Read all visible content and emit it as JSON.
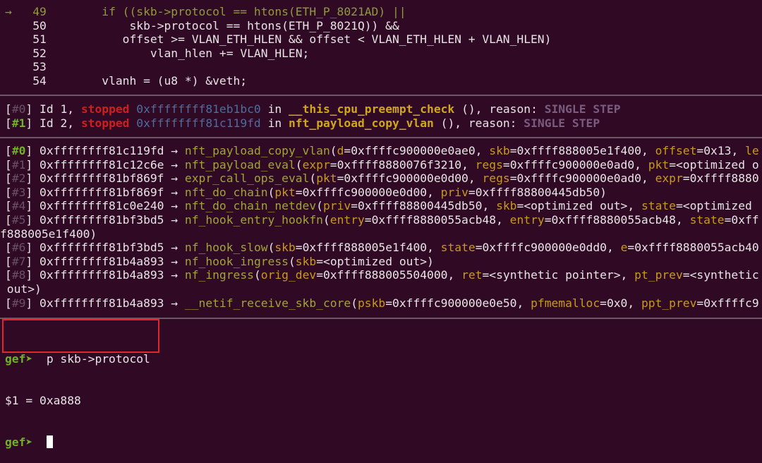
{
  "source": {
    "current_marker": "→",
    "lines": [
      {
        "num": "49",
        "code": "if ((skb->protocol == htons(ETH_P_8021AD) ||",
        "indent": "        ",
        "current": true
      },
      {
        "num": "50",
        "code": "skb->protocol == htons(ETH_P_8021Q)) &&",
        "indent": "            ",
        "current": false
      },
      {
        "num": "51",
        "code": "offset >= VLAN_ETH_HLEN && offset < VLAN_ETH_HLEN + VLAN_HLEN)",
        "indent": "           ",
        "current": false
      },
      {
        "num": "52",
        "code": "vlan_hlen += VLAN_HLEN;",
        "indent": "               ",
        "current": false
      },
      {
        "num": "53",
        "code": "",
        "indent": "",
        "current": false
      },
      {
        "num": "54",
        "code": "vlanh = (u8 *) &veth;",
        "indent": "        ",
        "current": false
      }
    ]
  },
  "threads": [
    {
      "index": "#0",
      "id": "Id 1,",
      "status": "stopped",
      "address": "0xffffffff81eb1bc0",
      "in": "in",
      "func": "__this_cpu_preempt_check",
      "suffix": "(), reason:",
      "reason": "SINGLE STEP"
    },
    {
      "index": "#1",
      "id": "Id 2,",
      "status": "stopped",
      "address": "0xffffffff81c119fd",
      "in": "in",
      "func": "nft_payload_copy_vlan",
      "suffix": "(), reason:",
      "reason": "SINGLE STEP"
    }
  ],
  "frames": [
    {
      "index": "#0",
      "address": "0xffffffff81c119fd",
      "arrow": "→",
      "func": "nft_payload_copy_vlan",
      "args": [
        {
          "name": "d",
          "value": "0xffffc900000e0ae0"
        },
        {
          "name": "skb",
          "value": "0xffff888005e1f400"
        },
        {
          "name": "offset",
          "value": "0x13"
        },
        {
          "name": "le",
          "value": ""
        }
      ]
    },
    {
      "index": "#1",
      "address": "0xffffffff81c12c6e",
      "arrow": "→",
      "func": "nft_payload_eval",
      "args": [
        {
          "name": "expr",
          "value": "0xffff8880076f3210"
        },
        {
          "name": "regs",
          "value": "0xffffc900000e0ad0"
        },
        {
          "name": "pkt",
          "value": "<optimized o"
        }
      ]
    },
    {
      "index": "#2",
      "address": "0xffffffff81bf869f",
      "arrow": "→",
      "func": "expr_call_ops_eval",
      "args": [
        {
          "name": "pkt",
          "value": "0xffffc900000e0d00"
        },
        {
          "name": "regs",
          "value": "0xffffc900000e0ad0"
        },
        {
          "name": "expr",
          "value": "0xffff8880"
        }
      ]
    },
    {
      "index": "#3",
      "address": "0xffffffff81bf869f",
      "arrow": "→",
      "func": "nft_do_chain",
      "args": [
        {
          "name": "pkt",
          "value": "0xffffc900000e0d00"
        },
        {
          "name": "priv",
          "value": "0xffff88800445db50)"
        }
      ]
    },
    {
      "index": "#4",
      "address": "0xffffffff81c0e240",
      "arrow": "→",
      "func": "nft_do_chain_netdev",
      "args": [
        {
          "name": "priv",
          "value": "0xffff88800445db50"
        },
        {
          "name": "skb",
          "value": "<optimized out>"
        },
        {
          "name": "state",
          "value": "<optimized"
        }
      ]
    },
    {
      "index": "#5",
      "address": "0xffffffff81bf3bd5",
      "arrow": "→",
      "func": "nf_hook_entry_hookfn",
      "args": [
        {
          "name": "entry",
          "value": "0xffff8880055acb48"
        },
        {
          "name": "entry",
          "value": "0xffff8880055acb48"
        },
        {
          "name": "state",
          "value": "0xff"
        }
      ],
      "continuation": "f888005e1f400)"
    },
    {
      "index": "#6",
      "address": "0xffffffff81bf3bd5",
      "arrow": "→",
      "func": "nf_hook_slow",
      "args": [
        {
          "name": "skb",
          "value": "0xffff888005e1f400"
        },
        {
          "name": "state",
          "value": "0xffffc900000e0dd0"
        },
        {
          "name": "e",
          "value": "0xffff8880055acb40"
        }
      ]
    },
    {
      "index": "#7",
      "address": "0xffffffff81b4a893",
      "arrow": "→",
      "func": "nf_hook_ingress",
      "args": [
        {
          "name": "skb",
          "value": "<optimized out>)"
        }
      ]
    },
    {
      "index": "#8",
      "address": "0xffffffff81b4a893",
      "arrow": "→",
      "func": "nf_ingress",
      "args": [
        {
          "name": "orig_dev",
          "value": "0xffff888005504000"
        },
        {
          "name": "ret",
          "value": "<synthetic pointer>"
        },
        {
          "name": "pt_prev",
          "value": "<synthetic"
        }
      ],
      "continuation": " out>)"
    },
    {
      "index": "#9",
      "address": "0xffffffff81b4a893",
      "arrow": "→",
      "func": "__netif_receive_skb_core",
      "args": [
        {
          "name": "pskb",
          "value": "0xffffc900000e0e50"
        },
        {
          "name": "pfmemalloc",
          "value": "0x0"
        },
        {
          "name": "ppt_prev",
          "value": "0xffffc9"
        }
      ]
    }
  ],
  "console": {
    "prompt": "gef➤",
    "command": "p skb->protocol",
    "result": "$1 = 0xa888",
    "highlight_color": "#e0262a"
  }
}
